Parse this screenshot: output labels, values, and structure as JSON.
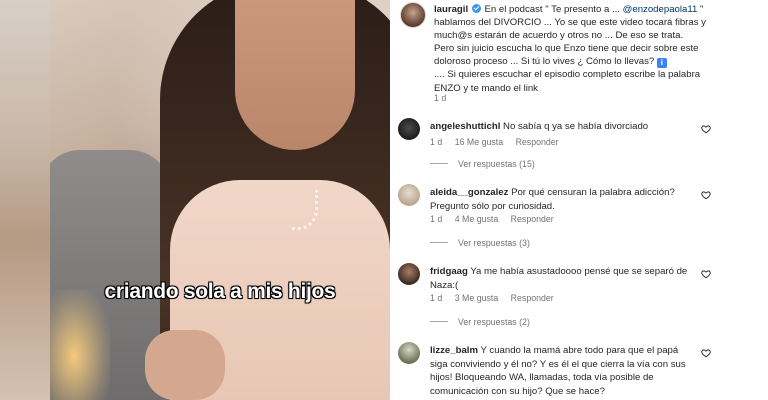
{
  "post": {
    "username": "lauragil",
    "text_1": " En el podcast \" Te presento a ... ",
    "mention": "@enzodepaola11",
    "text_2": " \" hablamos del DIVORCIO ... Yo se que este video tocará fibras y much@s estarán de acuerdo y otros no ... De eso se trata. Pero sin juicio escucha lo que Enzo tiene que decir sobre este doloroso proceso ... Si tú lo vives ¿ Cómo lo llevas? ",
    "text_3": ".... Si quieres escuchar el episodio completo escribe la palabra ENZO y te mando el link",
    "time": "1 d",
    "info_icon": "info-icon"
  },
  "video": {
    "caption": "criando sola a mis hijos"
  },
  "comments": [
    {
      "username": "angeleshuttichl",
      "text": "No sabía q ya se había divorciado",
      "time": "1 d",
      "likes": "16 Me gusta",
      "reply": "Responder",
      "replies": "Ver respuestas (15)"
    },
    {
      "username": "aleida__gonzalez",
      "text": "Por qué censuran la palabra adicción? Pregunto sólo por curiosidad.",
      "time": "1 d",
      "likes": "4 Me gusta",
      "reply": "Responder",
      "replies": "Ver respuestas (3)"
    },
    {
      "username": "fridgaag",
      "text": "Ya me había asustadoooo pensé que se separó de Naza:(",
      "time": "1 d",
      "likes": "3 Me gusta",
      "reply": "Responder",
      "replies": "Ver respuestas (2)"
    },
    {
      "username": "lizze_balm",
      "text": "Y cuando la mamá abre todo para que el papá siga conviviendo y él no? Y es él el que cierra la vía con sus hijos! Bloqueando WA, llamadas, toda vía posible de comunicación con su hijo? Que se hace?"
    }
  ],
  "colors": {
    "text": "#262626",
    "muted": "#737373",
    "mention": "#00376b",
    "verified": "#3897f0"
  }
}
